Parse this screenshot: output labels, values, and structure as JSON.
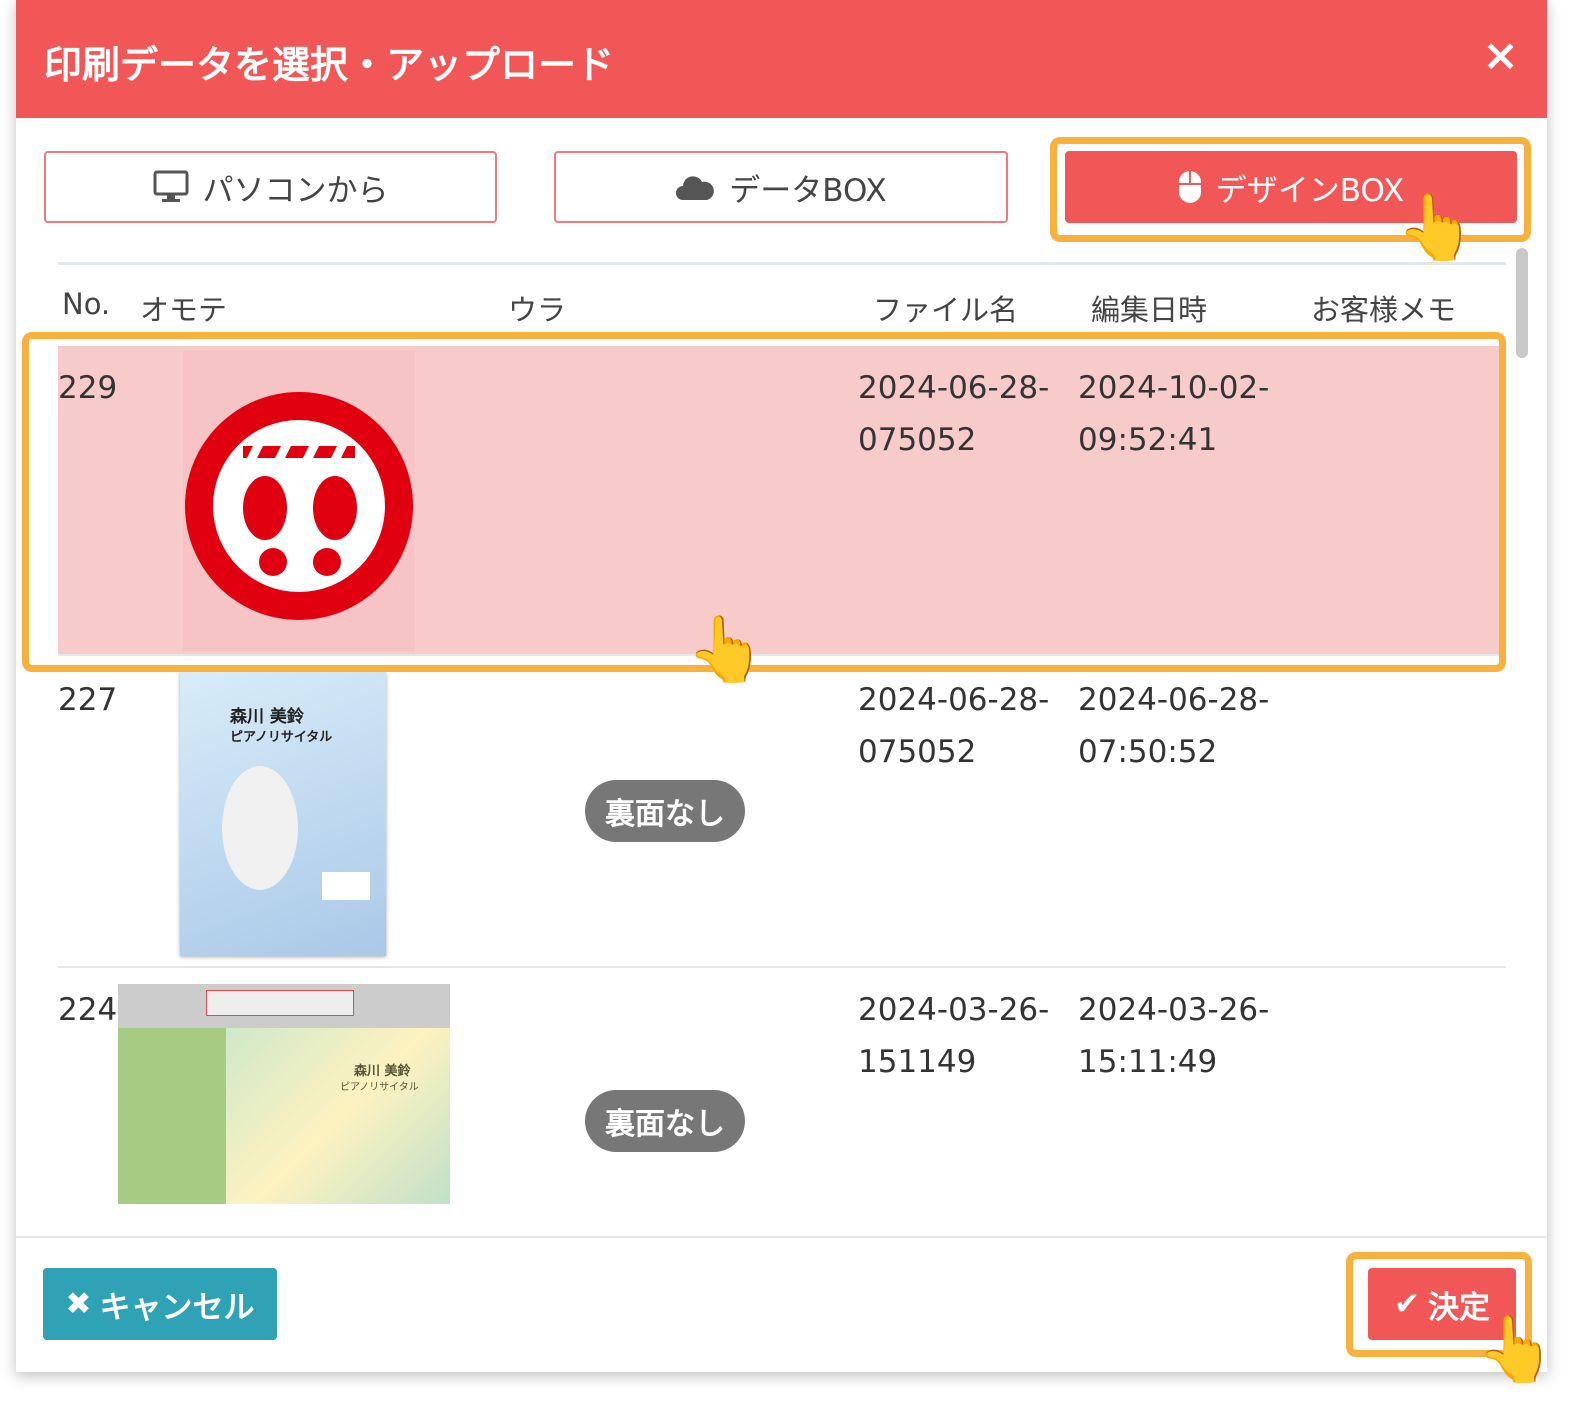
{
  "dialog": {
    "title": "印刷データを選択・アップロード",
    "close_icon": "×"
  },
  "sources": [
    {
      "label": "パソコンから",
      "icon": "monitor-icon"
    },
    {
      "label": "データBOX",
      "icon": "cloud-icon"
    },
    {
      "label": "デザインBOX",
      "icon": "mouse-icon",
      "active": true
    }
  ],
  "table": {
    "headers": {
      "no": "No.",
      "front": "オモテ",
      "back": "ウラ",
      "filename": "ファイル名",
      "edited": "編集日時",
      "memo": "お客様メモ"
    },
    "rows": [
      {
        "no": "229",
        "filename_1": "2024-06-28-",
        "filename_2": "075052",
        "edited_1": "2024-10-02-",
        "edited_2": "09:52:41",
        "back": "",
        "selected": true
      },
      {
        "no": "227",
        "filename_1": "2024-06-28-",
        "filename_2": "075052",
        "edited_1": "2024-06-28-",
        "edited_2": "07:50:52",
        "back": "裏面なし",
        "thumb_text_1": "森川 美鈴",
        "thumb_text_2": "ピアノリサイタル"
      },
      {
        "no": "224",
        "filename_1": "2024-03-26-",
        "filename_2": "151149",
        "edited_1": "2024-03-26-",
        "edited_2": "15:11:49",
        "back": "裏面なし",
        "thumb_text_1": "森川 美鈴",
        "thumb_text_2": "ピアノリサイタル"
      }
    ]
  },
  "footer": {
    "cancel_label": "キャンセル",
    "confirm_label": "決定"
  },
  "colors": {
    "primary": "#f25757",
    "highlight": "#f9b13e",
    "cancel": "#2fa3b5",
    "selected_row": "#f8cbcb"
  }
}
